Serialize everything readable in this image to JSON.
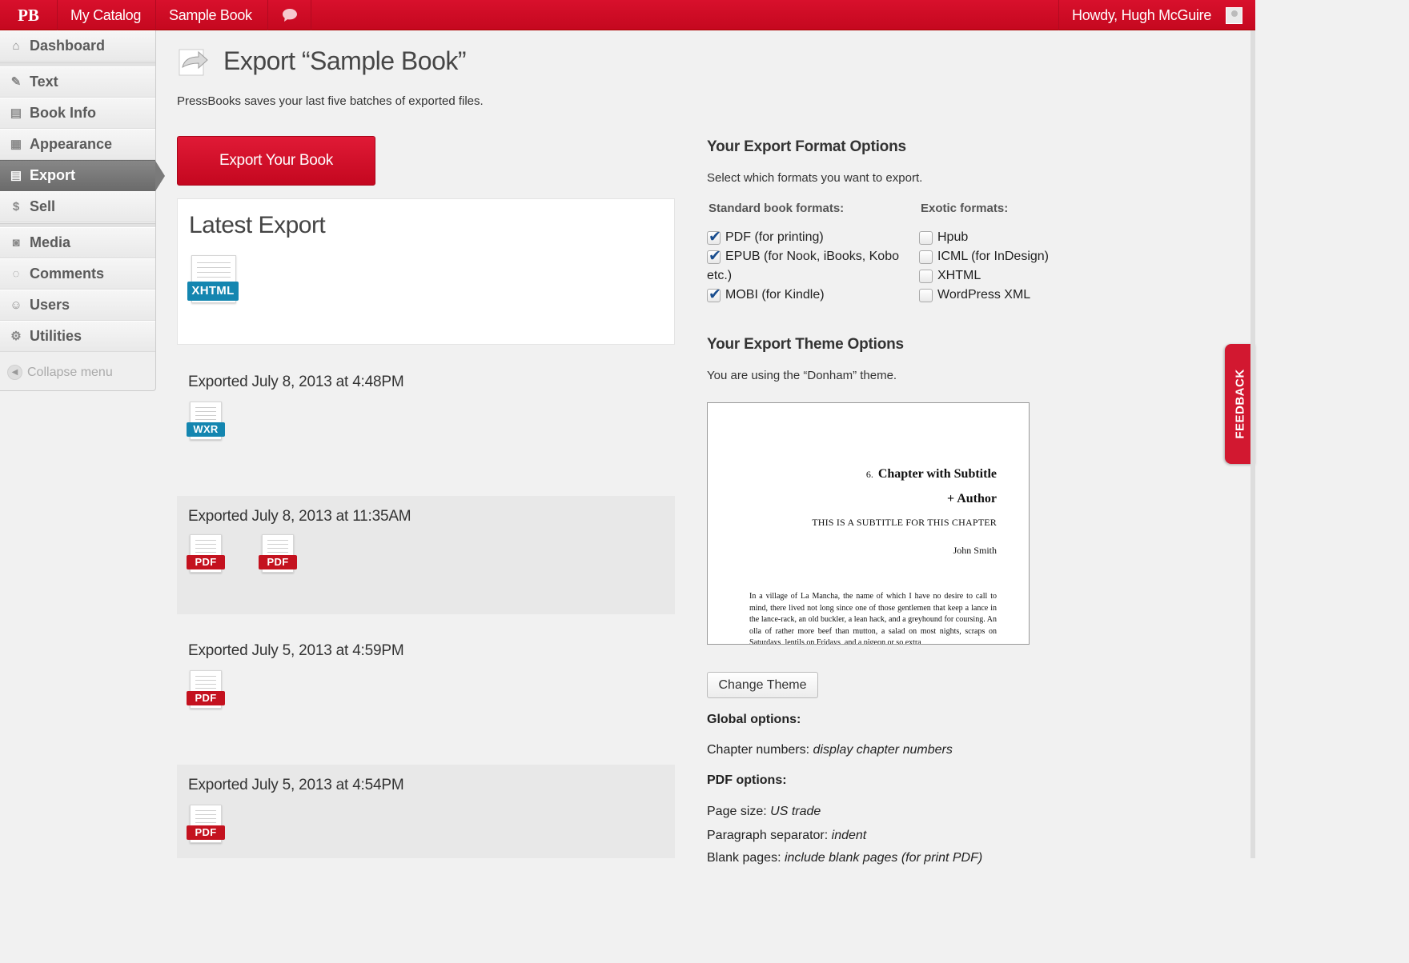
{
  "topbar": {
    "logo": "PB",
    "my_catalog": "My Catalog",
    "sample_book": "Sample Book",
    "howdy": "Howdy, Hugh McGuire"
  },
  "sidebar": {
    "items": [
      {
        "label": "Dashboard",
        "icon": "house-icon"
      },
      {
        "label": "Text",
        "icon": "pushpin-icon"
      },
      {
        "label": "Book Info",
        "icon": "book-icon"
      },
      {
        "label": "Appearance",
        "icon": "layout-icon"
      },
      {
        "label": "Export",
        "icon": "export-icon"
      },
      {
        "label": "Sell",
        "icon": "dollar-icon"
      },
      {
        "label": "Media",
        "icon": "camera-icon"
      },
      {
        "label": "Comments",
        "icon": "speech-bubble-icon"
      },
      {
        "label": "Users",
        "icon": "users-icon"
      },
      {
        "label": "Utilities",
        "icon": "wrench-icon"
      }
    ],
    "collapse": "Collapse menu"
  },
  "page": {
    "title": "Export “Sample Book”",
    "intro": "PressBooks saves your last five batches of exported files.",
    "export_button": "Export Your Book"
  },
  "exports": {
    "latest_title": "Latest Export",
    "latest_files": [
      "XHTML"
    ],
    "batches": [
      {
        "date": "Exported July 8, 2013 at 4:48PM",
        "files": [
          "WXR"
        ]
      },
      {
        "date": "Exported July 8, 2013 at 11:35AM",
        "files": [
          "PDF",
          "PDF"
        ]
      },
      {
        "date": "Exported July 5, 2013 at 4:59PM",
        "files": [
          "PDF"
        ]
      },
      {
        "date": "Exported July 5, 2013 at 4:54PM",
        "files": [
          "PDF"
        ]
      }
    ]
  },
  "formats": {
    "heading": "Your Export Format Options",
    "intro": "Select which formats you want to export.",
    "standard_heading": "Standard book formats:",
    "exotic_heading": "Exotic formats:",
    "standard": [
      {
        "label": "PDF (for printing)",
        "checked": true
      },
      {
        "label": "EPUB (for Nook, iBooks, Kobo etc.)",
        "checked": true
      },
      {
        "label": "MOBI (for Kindle)",
        "checked": true
      }
    ],
    "exotic": [
      {
        "label": "Hpub",
        "checked": false
      },
      {
        "label": "ICML (for InDesign)",
        "checked": false
      },
      {
        "label": "XHTML",
        "checked": false
      },
      {
        "label": "WordPress XML",
        "checked": false
      }
    ]
  },
  "theme": {
    "heading": "Your Export Theme Options",
    "using": "You are using the “Donham” theme.",
    "preview": {
      "chapter_num": "6.",
      "chapter_title": "Chapter with Subtitle",
      "author_line": "+ Author",
      "subtitle": "THIS IS A SUBTITLE FOR THIS CHAPTER",
      "name": "John Smith",
      "body": "In a village of La Mancha, the name of which I have no desire to call to mind, there lived not long since one of those gentlemen that keep a lance in the lance-rack, an old buckler, a lean hack, and a greyhound for coursing. An olla of rather more beef than mutton, a salad on most nights, scraps on Saturdays, lentils on Fridays, and a pigeon or so extra"
    },
    "change_button": "Change Theme"
  },
  "options": {
    "global_heading": "Global options:",
    "chapter_numbers_label": "Chapter numbers:",
    "chapter_numbers_value": "display chapter numbers",
    "pdf_heading": "PDF options:",
    "page_size_label": "Page size:",
    "page_size_value": "US trade",
    "para_sep_label": "Paragraph separator:",
    "para_sep_value": "indent",
    "blank_pages_label": "Blank pages:",
    "blank_pages_value": "include blank pages (for print PDF)"
  },
  "feedback": "FEEDBACK",
  "colors": {
    "brand": "#d21830",
    "sidebar_active": "#787878",
    "pdf_tag": "#c4121f",
    "xhtml_tag": "#1486b0"
  }
}
